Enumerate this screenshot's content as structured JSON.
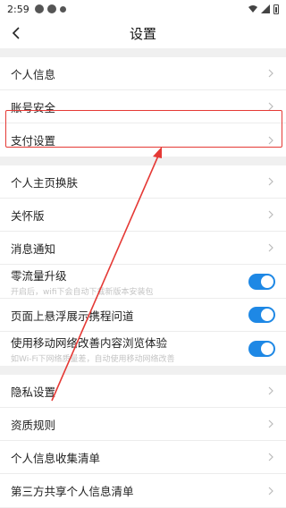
{
  "status_bar": {
    "time": "2:59"
  },
  "nav": {
    "title": "设置",
    "back_icon": "back-arrow-icon"
  },
  "group1": [
    {
      "label": "个人信息"
    },
    {
      "label": "账号安全"
    },
    {
      "label": "支付设置"
    }
  ],
  "group2": [
    {
      "label": "个人主页换肤"
    },
    {
      "label": "关怀版"
    },
    {
      "label": "消息通知"
    }
  ],
  "toggles": [
    {
      "label": "零流量升级",
      "sub": "开启后，wifi下会自动下载新版本安装包",
      "on": true
    },
    {
      "label": "页面上悬浮展示携程问道",
      "sub": "",
      "on": true
    },
    {
      "label": "使用移动网络改善内容浏览体验",
      "sub": "如Wi-Fi下网络质量差，自动使用移动网络改善",
      "on": true
    }
  ],
  "group3": [
    {
      "label": "隐私设置"
    },
    {
      "label": "资质规则"
    },
    {
      "label": "个人信息收集清单"
    },
    {
      "label": "第三方共享个人信息清单"
    }
  ],
  "colors": {
    "accent": "#1e88e5",
    "highlight": "#e53935"
  }
}
